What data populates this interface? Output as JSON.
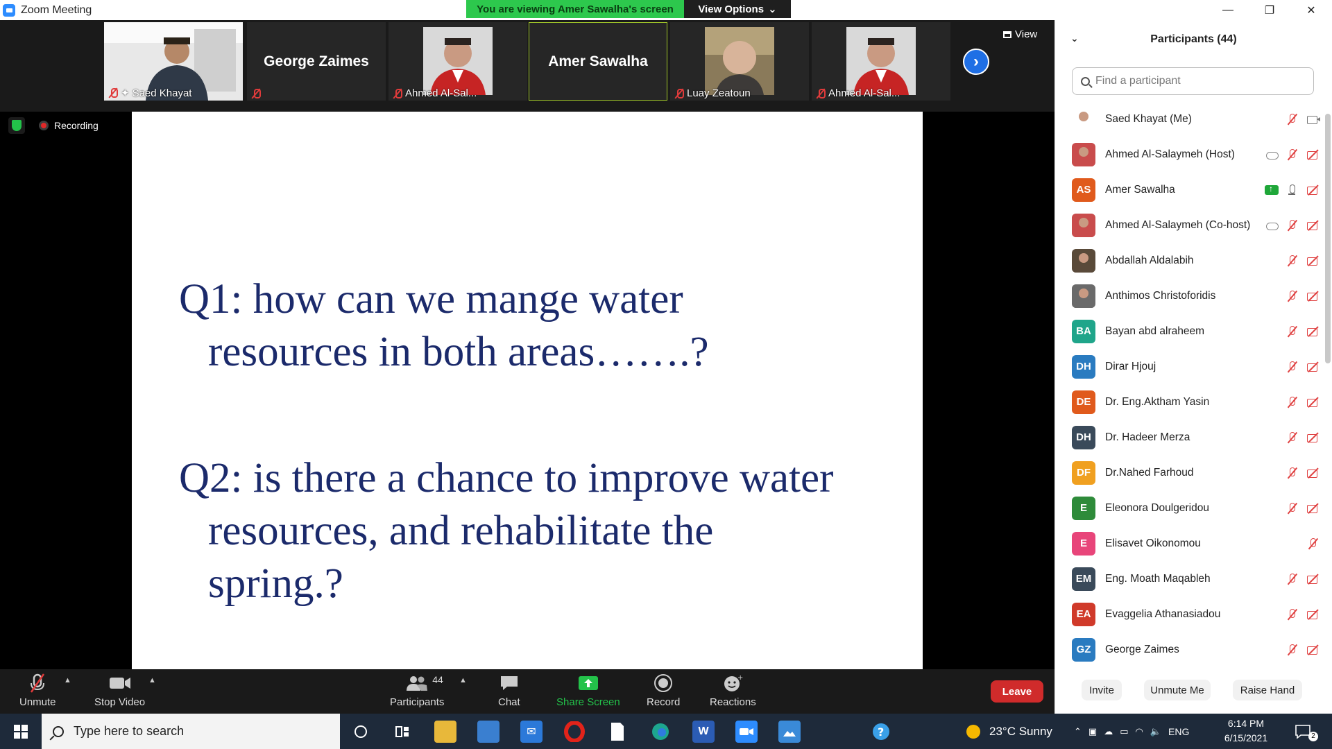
{
  "window": {
    "title": "Zoom Meeting",
    "viewing_banner": "You are viewing Amer Sawalha's screen",
    "view_options": "View Options"
  },
  "window_controls": {
    "minimize": "—",
    "restore": "❐",
    "close": "✕"
  },
  "strip": {
    "view_label": "View",
    "tiles": [
      {
        "name": "Saed Khayat",
        "kind": "video"
      },
      {
        "name": "George Zaimes",
        "kind": "name"
      },
      {
        "name": "Ahmed Al-Sal...",
        "kind": "photo"
      },
      {
        "name": "Amer Sawalha",
        "kind": "name-active"
      },
      {
        "name": "Luay Zeatoun",
        "kind": "photo"
      },
      {
        "name": "Ahmed Al-Sal...",
        "kind": "photo"
      }
    ]
  },
  "recording_label": "Recording",
  "slide": {
    "q1_line1": "Q1: how can we mange water",
    "q1_line2": "resources in both areas…….?",
    "q2_line1": "Q2: is there a chance to improve water",
    "q2_line2": "resources, and rehabilitate the",
    "q2_line3": "spring.?",
    "text_color": "#1b2a6b"
  },
  "toolbar": {
    "unmute": "Unmute",
    "stop_video": "Stop Video",
    "participants": "Participants",
    "participants_count": "44",
    "chat": "Chat",
    "share_screen": "Share Screen",
    "record": "Record",
    "reactions": "Reactions",
    "leave": "Leave"
  },
  "panel": {
    "title": "Participants (44)",
    "search_placeholder": "Find a participant",
    "participants": [
      {
        "name": "Saed Khayat (Me)",
        "initials": "",
        "color": "#ffffff",
        "status": [
          "mic-off",
          "cam"
        ]
      },
      {
        "name": "Ahmed Al-Salaymeh (Host)",
        "initials": "",
        "color": "#c94c4c",
        "status": [
          "cloud",
          "mic-off",
          "cam-off"
        ]
      },
      {
        "name": "Amer Sawalha",
        "initials": "AS",
        "color": "#e05a1c",
        "status": [
          "share",
          "mic",
          "cam-off"
        ]
      },
      {
        "name": "Ahmed Al-Salaymeh (Co-host)",
        "initials": "",
        "color": "#c94c4c",
        "status": [
          "cloud",
          "mic-off",
          "cam-off"
        ]
      },
      {
        "name": "Abdallah Aldalabih",
        "initials": "",
        "color": "#5a4a3a",
        "status": [
          "mic-off",
          "cam-off"
        ]
      },
      {
        "name": "Anthimos Christoforidis",
        "initials": "",
        "color": "#6a6a6a",
        "status": [
          "mic-off",
          "cam-off"
        ]
      },
      {
        "name": "Bayan abd  alraheem",
        "initials": "BA",
        "color": "#1fa58a",
        "status": [
          "mic-off",
          "cam-off"
        ]
      },
      {
        "name": "Dirar Hjouj",
        "initials": "DH",
        "color": "#2a7bc0",
        "status": [
          "mic-off",
          "cam-off"
        ]
      },
      {
        "name": "Dr. Eng.Aktham Yasin",
        "initials": "DE",
        "color": "#e05a1c",
        "status": [
          "mic-off",
          "cam-off"
        ]
      },
      {
        "name": "Dr. Hadeer Merza",
        "initials": "DH",
        "color": "#3a4a5a",
        "status": [
          "mic-off",
          "cam-off"
        ]
      },
      {
        "name": "Dr.Nahed Farhoud",
        "initials": "DF",
        "color": "#f0a020",
        "status": [
          "mic-off",
          "cam-off"
        ]
      },
      {
        "name": "Eleonora Doulgeridou",
        "initials": "E",
        "color": "#2e8b3a",
        "status": [
          "mic-off",
          "cam-off"
        ]
      },
      {
        "name": "Elisavet Oikonomou",
        "initials": "E",
        "color": "#e8457a",
        "status": [
          "mic-off"
        ]
      },
      {
        "name": "Eng. Moath Maqableh",
        "initials": "EM",
        "color": "#3a4a5a",
        "status": [
          "mic-off",
          "cam-off"
        ]
      },
      {
        "name": "Evaggelia Athanasiadou",
        "initials": "EA",
        "color": "#d03a2a",
        "status": [
          "mic-off",
          "cam-off"
        ]
      },
      {
        "name": "George Zaimes",
        "initials": "GZ",
        "color": "#2a7bc0",
        "status": [
          "mic-off",
          "cam-off"
        ]
      }
    ],
    "invite": "Invite",
    "unmute_me": "Unmute Me",
    "raise_hand": "Raise Hand"
  },
  "taskbar": {
    "search_placeholder": "Type here to search",
    "weather": "23°C  Sunny",
    "language": "ENG",
    "time": "6:14 PM",
    "date": "6/15/2021",
    "notifications": "2"
  }
}
